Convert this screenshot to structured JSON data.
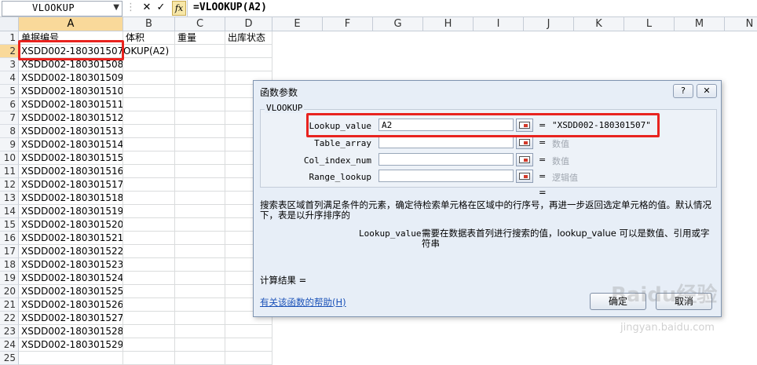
{
  "formula_bar": {
    "name_box": "VLOOKUP",
    "cancel_icon": "✕",
    "enter_icon": "✓",
    "fx_label": "fx",
    "formula": "=VLOOKUP(A2)"
  },
  "columns": [
    "A",
    "B",
    "C",
    "D",
    "E",
    "F",
    "G",
    "H",
    "I",
    "J",
    "K",
    "L",
    "M",
    "N"
  ],
  "rows": [
    "1",
    "2",
    "3",
    "4",
    "5",
    "6",
    "7",
    "8",
    "9",
    "10",
    "11",
    "12",
    "13",
    "14",
    "15",
    "16",
    "17",
    "18",
    "19",
    "20",
    "21",
    "22",
    "23",
    "24",
    "25"
  ],
  "headers_row": {
    "A": "单据编号",
    "B": "体积",
    "C": "重量",
    "D": "出库状态"
  },
  "b2_value": "OKUP(A2)",
  "col_a_values": [
    "XSDD002-180301507",
    "XSDD002-180301508",
    "XSDD002-180301509",
    "XSDD002-180301510",
    "XSDD002-180301511",
    "XSDD002-180301512",
    "XSDD002-180301513",
    "XSDD002-180301514",
    "XSDD002-180301515",
    "XSDD002-180301516",
    "XSDD002-180301517",
    "XSDD002-180301518",
    "XSDD002-180301519",
    "XSDD002-180301520",
    "XSDD002-180301521",
    "XSDD002-180301522",
    "XSDD002-180301523",
    "XSDD002-180301524",
    "XSDD002-180301525",
    "XSDD002-180301526",
    "XSDD002-180301527",
    "XSDD002-180301528",
    "XSDD002-180301529"
  ],
  "dialog": {
    "title": "函数参数",
    "help_btn": "?",
    "close_btn": "✕",
    "function_name": "VLOOKUP",
    "args": [
      {
        "label": "Lookup_value",
        "input": "A2",
        "eq": "=",
        "value": "\"XSDD002-180301507\""
      },
      {
        "label": "Table_array",
        "input": "",
        "eq": "=",
        "value": "数值"
      },
      {
        "label": "Col_index_num",
        "input": "",
        "eq": "=",
        "value": "数值"
      },
      {
        "label": "Range_lookup",
        "input": "",
        "eq": "=",
        "value": "逻辑值"
      }
    ],
    "result_eq": "=",
    "description": "搜索表区域首列满足条件的元素，确定待检索单元格在区域中的行序号，再进一步返回选定单元格的值。默认情况下，表是以升序排序的",
    "arg_name": "Lookup_value",
    "arg_desc": "需要在数据表首列进行搜索的值，lookup_value 可以是数值、引用或字符串",
    "calc_result": "计算结果 =",
    "help_link": "有关该函数的帮助(H)",
    "ok": "确定",
    "cancel": "取消"
  },
  "watermark": {
    "text": "Baidu经验",
    "url": "jingyan.baidu.com"
  },
  "colors": {
    "highlight_red": "#e8231f",
    "selected_header": "#f9d99a",
    "dialog_bg": "#e7eef7"
  }
}
